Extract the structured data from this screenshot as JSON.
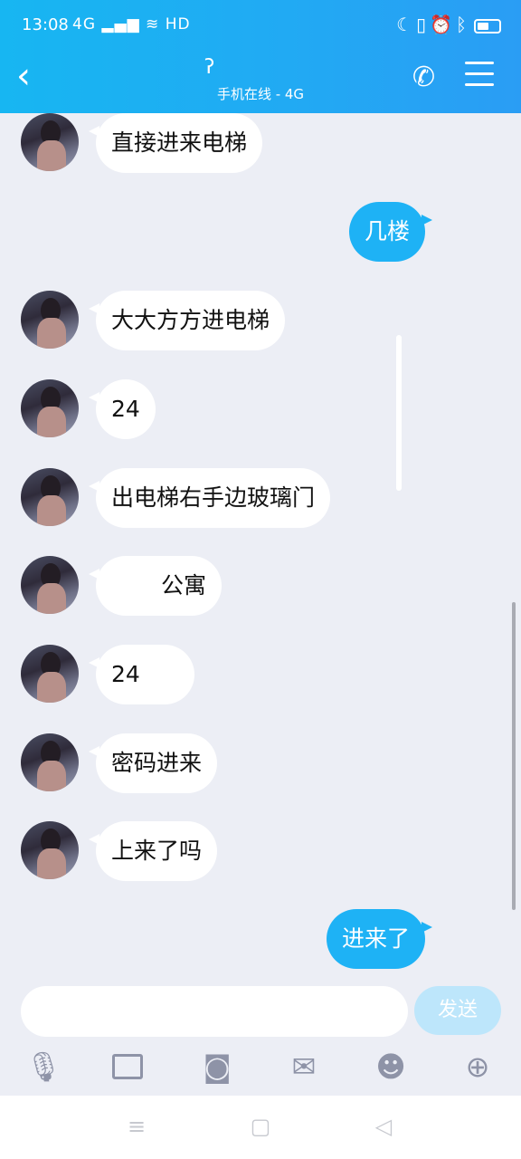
{
  "status_bar": {
    "time": "13:08",
    "signal": "4G",
    "network": "HD",
    "right_icons": [
      "moon-icon",
      "vibrate-icon",
      "alarm-icon",
      "bluetooth-icon",
      "battery-icon"
    ]
  },
  "header": {
    "subtitle": "手机在线 - 4G",
    "accent": "#1eb2f5"
  },
  "messages": [
    {
      "side": "in",
      "text": "直接进来电梯"
    },
    {
      "side": "out",
      "text": "几楼"
    },
    {
      "side": "in",
      "text": "大大方方进电梯"
    },
    {
      "side": "in",
      "text": "24"
    },
    {
      "side": "in",
      "text": "出电梯右手边玻璃门"
    },
    {
      "side": "in",
      "text": "公寓"
    },
    {
      "side": "in",
      "text": "24"
    },
    {
      "side": "in",
      "text": "密码进来"
    },
    {
      "side": "in",
      "text": "上来了吗"
    },
    {
      "side": "out",
      "text": "进来了"
    }
  ],
  "composer": {
    "input_value": "",
    "send_label": "发送"
  },
  "toolbar": [
    "microphone-icon",
    "image-icon",
    "camera-icon",
    "red-packet-icon",
    "emoji-icon",
    "plus-icon"
  ]
}
